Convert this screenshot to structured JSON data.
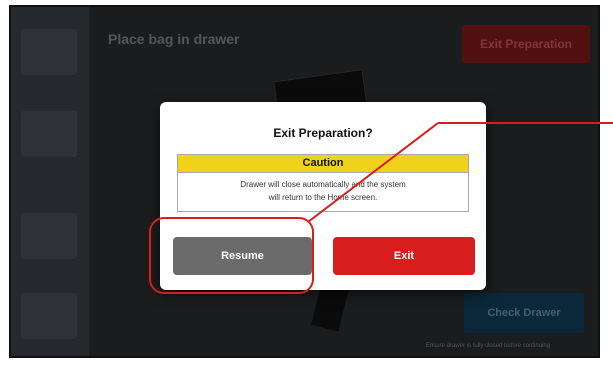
{
  "background": {
    "title": "Place bag in drawer",
    "exit_button_label": "Exit Preparation",
    "check_button_label": "Check Drawer",
    "footer_note": "Ensure drawer is fully closed before continuing"
  },
  "dialog": {
    "title": "Exit Preparation?",
    "caution": {
      "header": "Caution",
      "message_line1": "Drawer will close automatically and the system",
      "message_line2": "will return to the Home screen."
    },
    "resume_label": "Resume",
    "exit_label": "Exit"
  },
  "colors": {
    "caution_header": "#f1d21b",
    "exit_button": "#d81d1d",
    "resume_button": "#6b6b6b",
    "callout": "#d81d1d"
  }
}
